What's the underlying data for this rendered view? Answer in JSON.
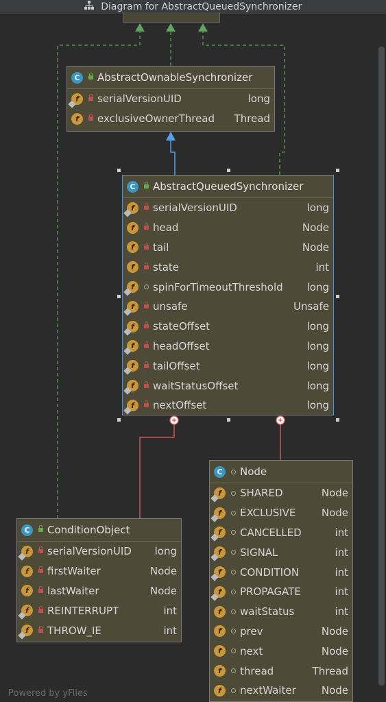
{
  "window": {
    "title": "Diagram for AbstractQueuedSynchronizer"
  },
  "footer": "Powered by yFiles",
  "classes": {
    "aos": {
      "name": "AbstractOwnableSynchronizer",
      "fields": [
        {
          "name": "serialVersionUID",
          "type": "long"
        },
        {
          "name": "exclusiveOwnerThread",
          "type": "Thread"
        }
      ]
    },
    "aqs": {
      "name": "AbstractQueuedSynchronizer",
      "fields": [
        {
          "name": "serialVersionUID",
          "type": "long"
        },
        {
          "name": "head",
          "type": "Node"
        },
        {
          "name": "tail",
          "type": "Node"
        },
        {
          "name": "state",
          "type": "int"
        },
        {
          "name": "spinForTimeoutThreshold",
          "type": "long"
        },
        {
          "name": "unsafe",
          "type": "Unsafe"
        },
        {
          "name": "stateOffset",
          "type": "long"
        },
        {
          "name": "headOffset",
          "type": "long"
        },
        {
          "name": "tailOffset",
          "type": "long"
        },
        {
          "name": "waitStatusOffset",
          "type": "long"
        },
        {
          "name": "nextOffset",
          "type": "long"
        }
      ]
    },
    "cond": {
      "name": "ConditionObject",
      "fields": [
        {
          "name": "serialVersionUID",
          "type": "long"
        },
        {
          "name": "firstWaiter",
          "type": "Node"
        },
        {
          "name": "lastWaiter",
          "type": "Node"
        },
        {
          "name": "REINTERRUPT",
          "type": "int"
        },
        {
          "name": "THROW_IE",
          "type": "int"
        }
      ]
    },
    "node": {
      "name": "Node",
      "fields": [
        {
          "name": "SHARED",
          "type": "Node"
        },
        {
          "name": "EXCLUSIVE",
          "type": "Node"
        },
        {
          "name": "CANCELLED",
          "type": "int"
        },
        {
          "name": "SIGNAL",
          "type": "int"
        },
        {
          "name": "CONDITION",
          "type": "int"
        },
        {
          "name": "PROPAGATE",
          "type": "int"
        },
        {
          "name": "waitStatus",
          "type": "int"
        },
        {
          "name": "prev",
          "type": "Node"
        },
        {
          "name": "next",
          "type": "Node"
        },
        {
          "name": "thread",
          "type": "Thread"
        },
        {
          "name": "nextWaiter",
          "type": "Node"
        }
      ]
    }
  },
  "colors": {
    "background": "#2b2b2b",
    "class_fill": "#4d4a38",
    "implements_edge": "#5fa85f",
    "extends_edge": "#5a9fe0",
    "inner_edge": "#e06060"
  }
}
